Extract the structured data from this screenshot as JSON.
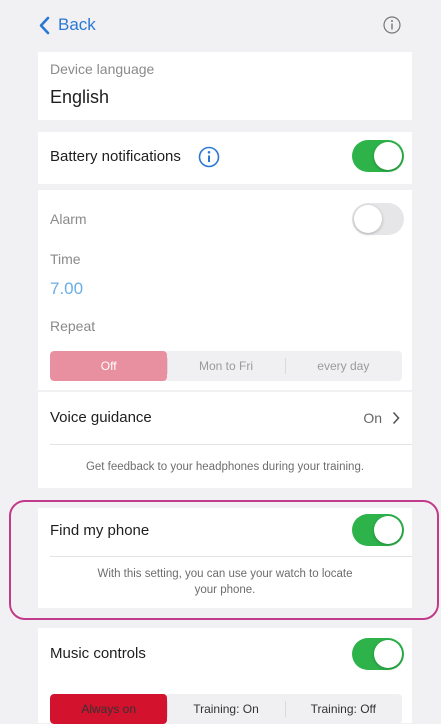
{
  "nav": {
    "back_label": "Back"
  },
  "device_language": {
    "label": "Device language",
    "value": "English"
  },
  "battery_notifications": {
    "label": "Battery notifications",
    "enabled": true
  },
  "alarm": {
    "label": "Alarm",
    "enabled": false,
    "time_label": "Time",
    "time_value": "7.00",
    "repeat_label": "Repeat",
    "repeat_options": [
      "Off",
      "Mon to Fri",
      "every day"
    ],
    "repeat_selected": "Off"
  },
  "voice_guidance": {
    "label": "Voice guidance",
    "value": "On",
    "description": "Get feedback to your headphones during your training."
  },
  "find_my_phone": {
    "label": "Find my phone",
    "enabled": true,
    "description": "With this setting, you can use your watch to locate your phone."
  },
  "music_controls": {
    "label": "Music controls",
    "enabled": true,
    "options": [
      "Always on",
      "Training: On",
      "Training: Off"
    ],
    "selected": "Always on"
  },
  "colors": {
    "accent_blue": "#2a78d6",
    "toggle_green": "#2db34a",
    "selected_pink": "#e8909f",
    "selected_red": "#d3122d",
    "highlight_magenta": "#c23a8a"
  }
}
